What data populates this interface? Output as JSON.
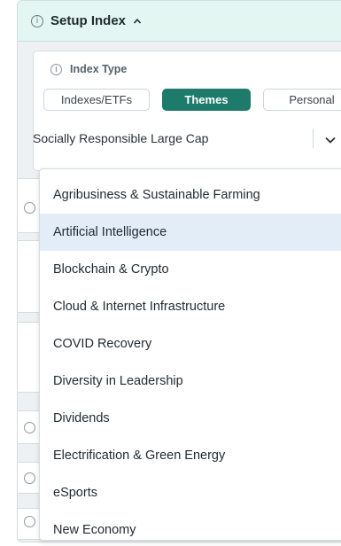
{
  "setup": {
    "title": "Setup Index"
  },
  "index_type": {
    "label": "Index Type",
    "tabs": [
      {
        "label": "Indexes/ETFs",
        "active": false
      },
      {
        "label": "Themes",
        "active": true
      },
      {
        "label": "Personal",
        "active": false
      }
    ],
    "selected_value": "Socially Responsible Large Cap"
  },
  "dropdown": {
    "highlighted_index": 1,
    "options": [
      "Agribusiness & Sustainable Farming",
      "Artificial Intelligence",
      "Blockchain & Crypto",
      "Cloud & Internet Infrastructure",
      "COVID Recovery",
      "Diversity in Leadership",
      "Dividends",
      "Electrification & Green Energy",
      "eSports",
      "New Economy"
    ]
  },
  "colors": {
    "accent": "#1e7a6b",
    "header_bg": "#e4f6f1",
    "highlight": "#e3edf8"
  }
}
